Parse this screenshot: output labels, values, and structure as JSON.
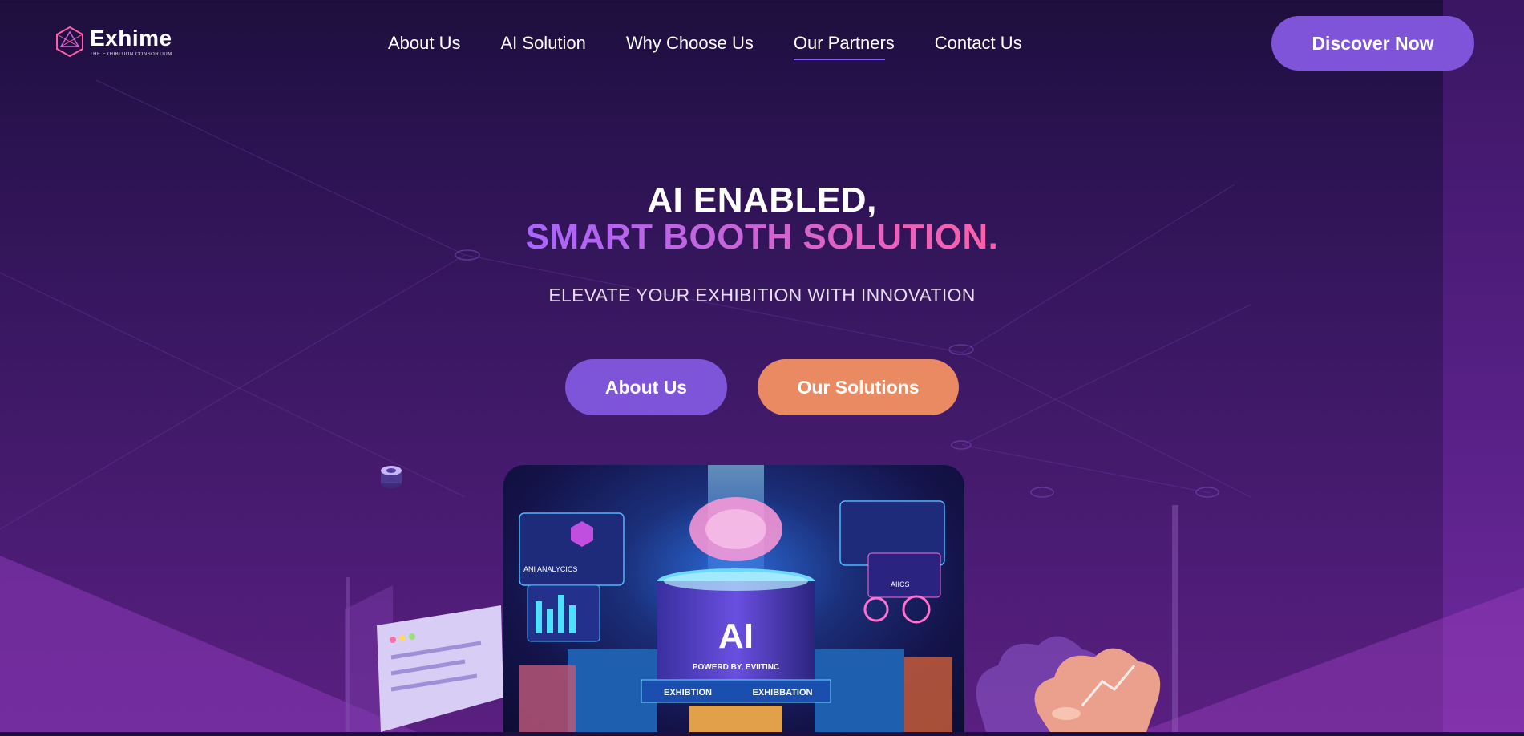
{
  "brand": {
    "name": "Exhime",
    "tagline": "THE EXHIBITION CONSORTIUM"
  },
  "nav": {
    "items": [
      {
        "label": "About Us"
      },
      {
        "label": "AI Solution"
      },
      {
        "label": "Why Choose Us"
      },
      {
        "label": "Our Partners",
        "active": true
      },
      {
        "label": "Contact Us"
      }
    ],
    "cta": "Discover Now"
  },
  "hero": {
    "title_line1": "AI ENABLED,",
    "title_line2": "SMART BOOTH SOLUTION.",
    "subtitle": "ELEVATE YOUR EXHIBITION WITH INNOVATION",
    "btn_primary": "About Us",
    "btn_secondary": "Our Solutions"
  },
  "hero_image": {
    "big_label": "AI",
    "powered": "POWERD BY, EVIITINC",
    "banner_left": "EXHIBTION",
    "banner_right": "EXHIBBATION",
    "panel_left": "ANI ANALYCICS",
    "panel_right": "AIICS"
  },
  "colors": {
    "primary": "#7f54d8",
    "secondary": "#e98a62",
    "gradient_start": "#a865ff",
    "gradient_end": "#ff5fa8",
    "nav_underline": "#8a5cff"
  }
}
